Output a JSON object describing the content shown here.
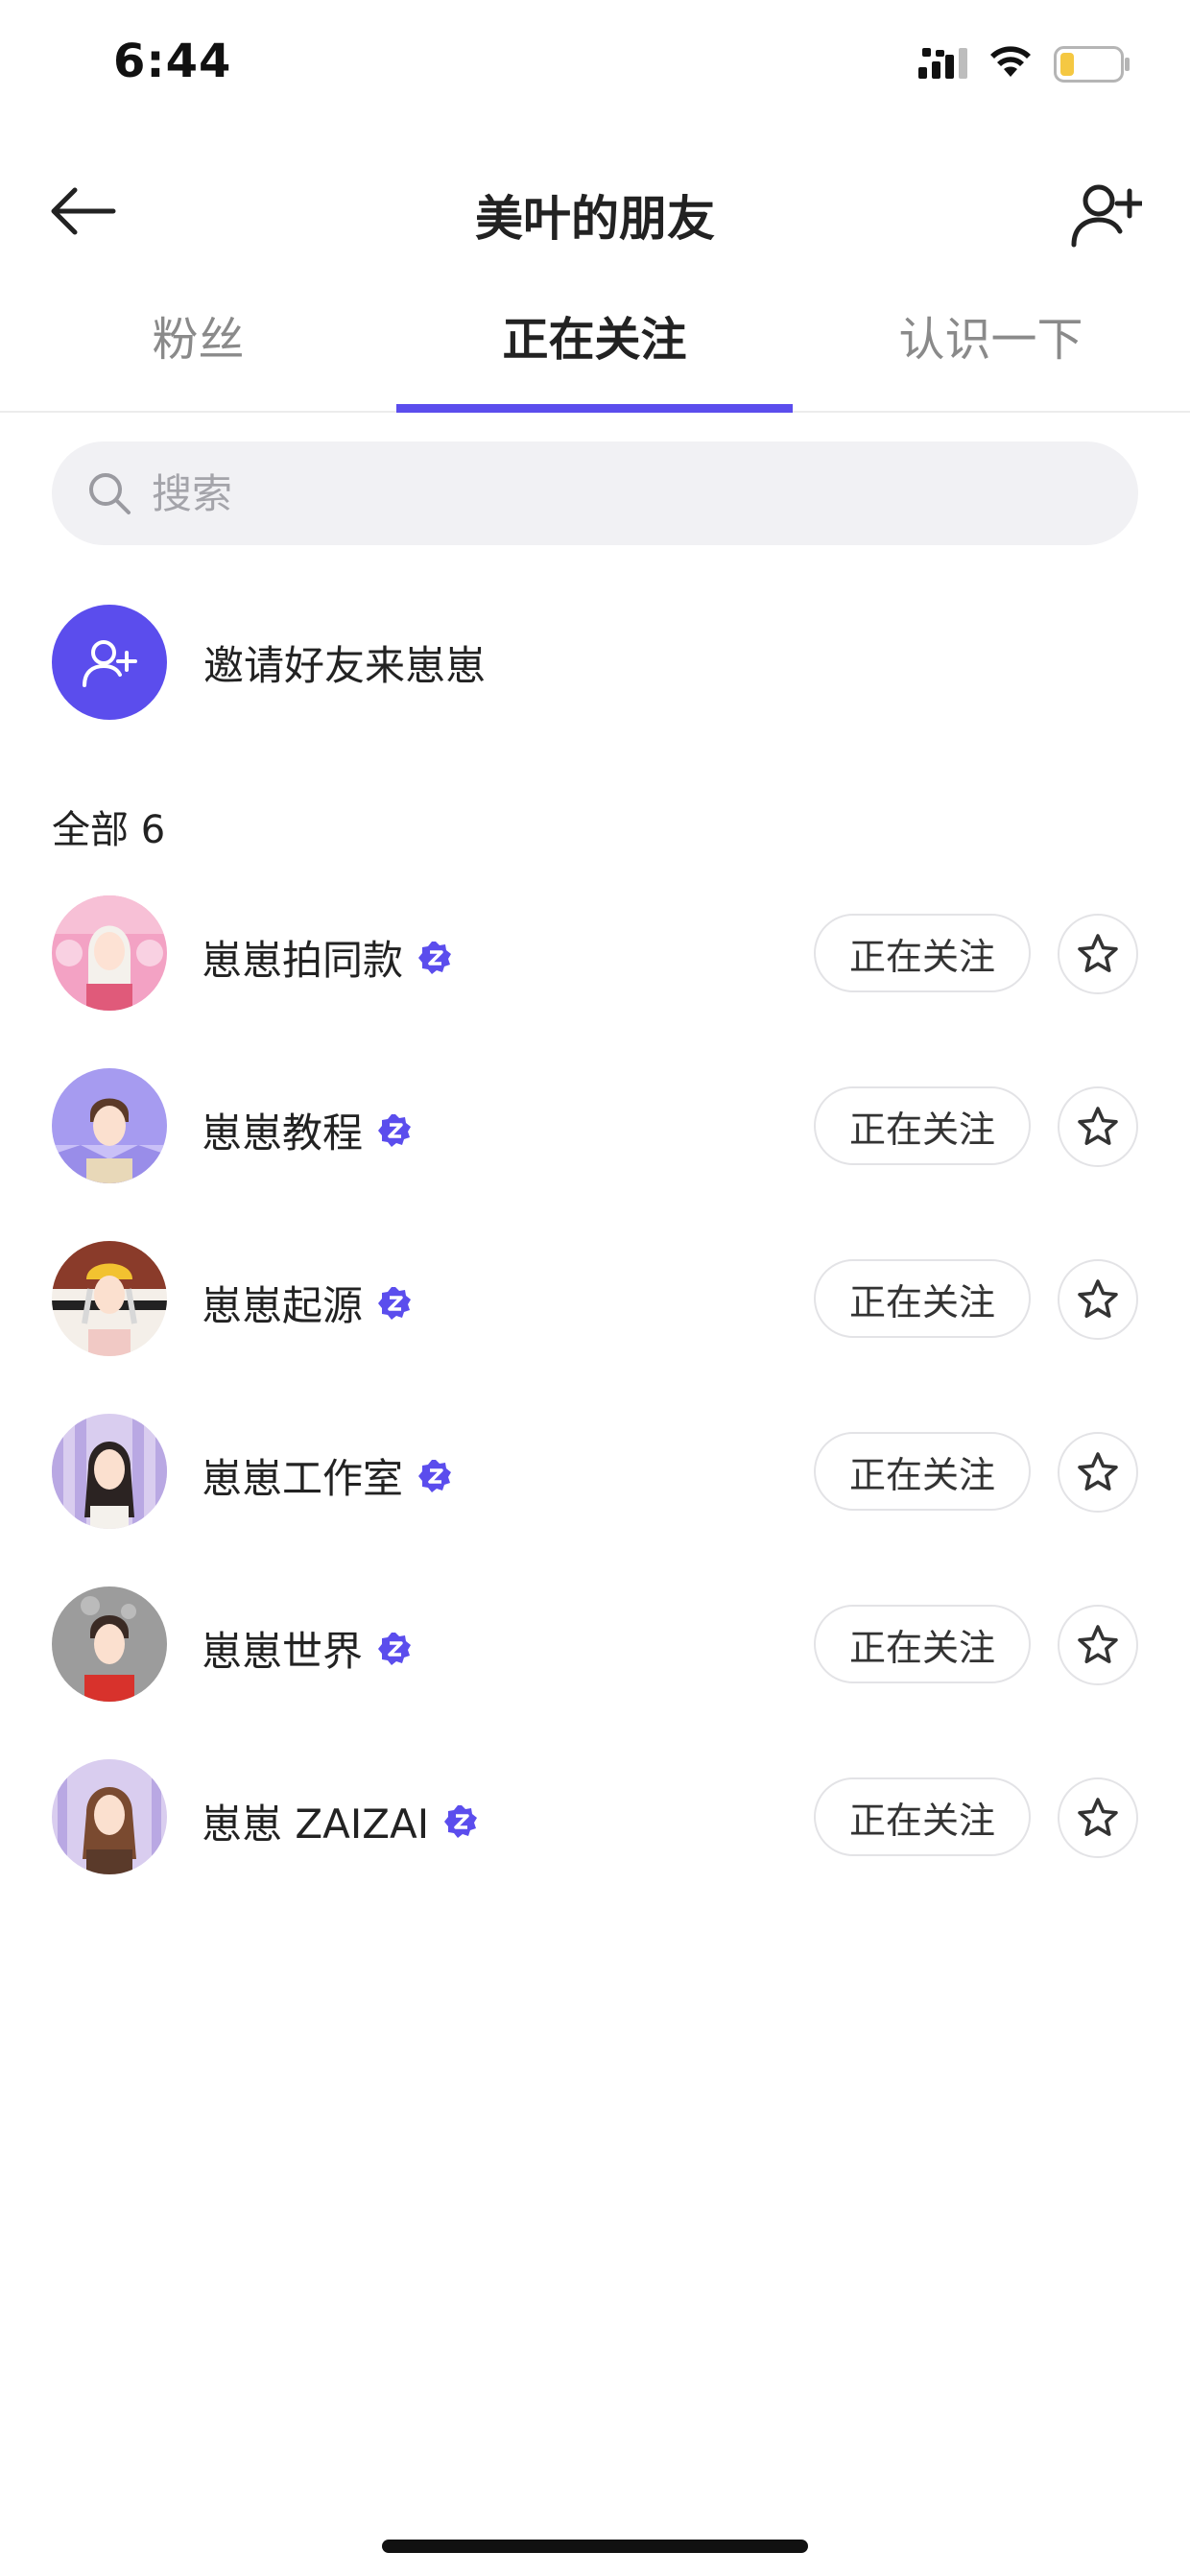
{
  "status_bar": {
    "time": "6:44"
  },
  "header": {
    "title": "美叶的朋友",
    "back_icon": "arrow-left-icon",
    "add_friend_icon": "user-plus-icon"
  },
  "tabs": [
    {
      "label": "粉丝",
      "active": false
    },
    {
      "label": "正在关注",
      "active": true
    },
    {
      "label": "认识一下",
      "active": false
    }
  ],
  "search": {
    "placeholder": "搜索",
    "value": ""
  },
  "invite": {
    "label": "邀请好友来崽崽",
    "icon": "user-plus-icon"
  },
  "section": {
    "title": "全部 6"
  },
  "friends": [
    {
      "name": "崽崽拍同款",
      "verified": true,
      "follow_label": "正在关注"
    },
    {
      "name": "崽崽教程",
      "verified": true,
      "follow_label": "正在关注"
    },
    {
      "name": "崽崽起源",
      "verified": true,
      "follow_label": "正在关注"
    },
    {
      "name": "崽崽工作室",
      "verified": true,
      "follow_label": "正在关注"
    },
    {
      "name": "崽崽世界",
      "verified": true,
      "follow_label": "正在关注"
    },
    {
      "name": "崽崽 ZAIZAI",
      "verified": true,
      "follow_label": "正在关注"
    }
  ],
  "colors": {
    "accent": "#5b4ded",
    "text": "#222222",
    "muted": "#8a8a8a",
    "search_bg": "#f1f1f4"
  }
}
